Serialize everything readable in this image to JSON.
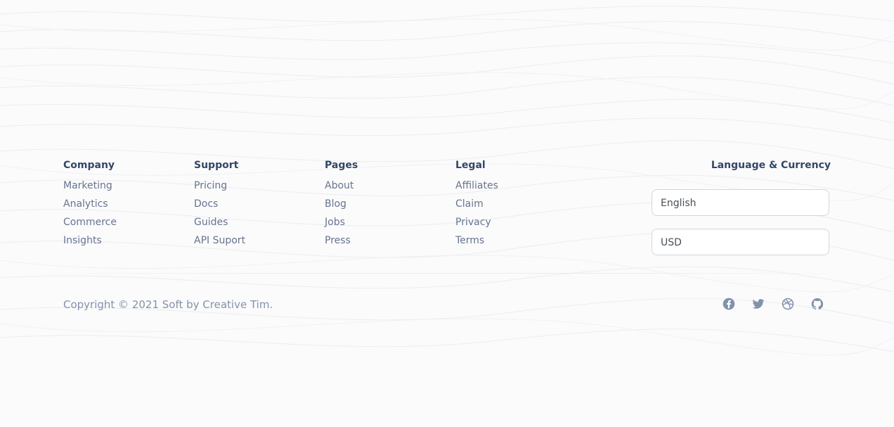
{
  "columns": [
    {
      "title": "Company",
      "links": [
        "Marketing",
        "Analytics",
        "Commerce",
        "Insights"
      ]
    },
    {
      "title": "Support",
      "links": [
        "Pricing",
        "Docs",
        "Guides",
        "API Suport"
      ]
    },
    {
      "title": "Pages",
      "links": [
        "About",
        "Blog",
        "Jobs",
        "Press"
      ]
    },
    {
      "title": "Legal",
      "links": [
        "Affiliates",
        "Claim",
        "Privacy",
        "Terms"
      ]
    }
  ],
  "language_currency": {
    "title": "Language & Currency",
    "language_value": "English",
    "currency_value": "USD"
  },
  "copyright": "Copyright © 2021 Soft by Creative Tim.",
  "socials": [
    "facebook-icon",
    "twitter-icon",
    "dribbble-icon",
    "github-icon"
  ],
  "colors": {
    "heading": "#344767",
    "link": "#67748e",
    "muted": "#8392ab",
    "icon": "#8392ab",
    "border": "#d2d6da"
  }
}
